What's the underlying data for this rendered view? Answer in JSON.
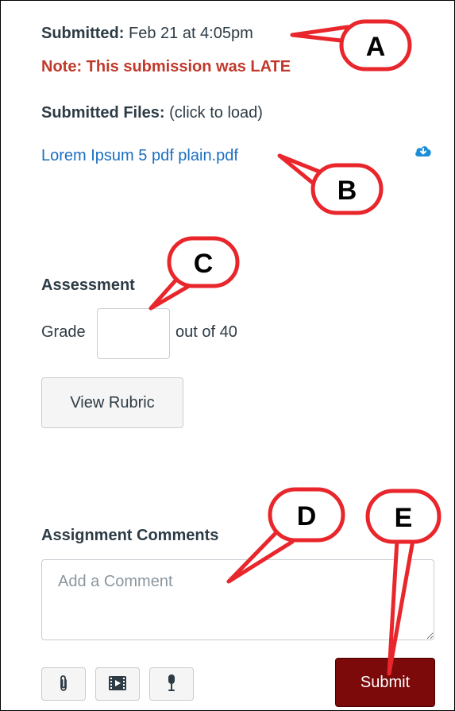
{
  "submission": {
    "submitted_label": "Submitted:",
    "submitted_value": " Feb 21 at 4:05pm",
    "late_note": "Note: This submission was LATE",
    "files_label": "Submitted Files:",
    "files_hint": " (click to load)",
    "file_name": "Lorem Ipsum 5 pdf plain.pdf",
    "download_icon": "cloud-download-icon"
  },
  "assessment": {
    "heading": "Assessment",
    "grade_label": "Grade",
    "grade_value": "",
    "out_of": "out of 40",
    "rubric_button": "View Rubric"
  },
  "comments": {
    "heading": "Assignment Comments",
    "placeholder": "Add a Comment",
    "tool_icons": [
      "paperclip-icon",
      "media-icon",
      "microphone-icon"
    ],
    "submit_label": "Submit"
  },
  "callouts": {
    "letters": [
      "A",
      "B",
      "C",
      "D",
      "E"
    ],
    "fill": "#ffffff",
    "stroke": "#e8262b"
  },
  "colors": {
    "late": "#c0392b",
    "link": "#1b6ec2",
    "submit": "#7c0a0a"
  }
}
